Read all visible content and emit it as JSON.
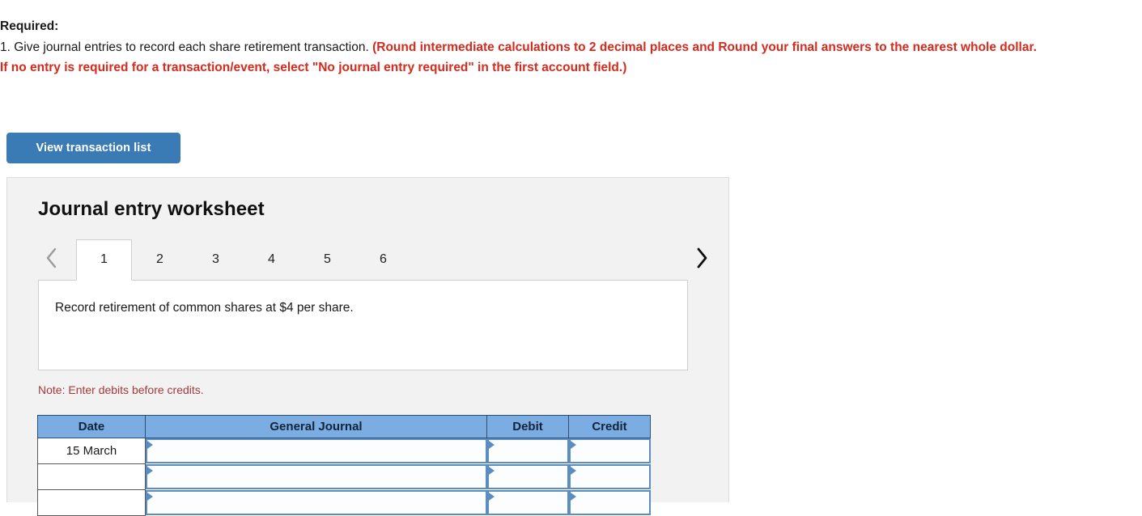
{
  "required": {
    "label": "Required:",
    "item_number": "1.",
    "instruction": "Give journal entries to record each share retirement transaction.",
    "emphasis_line1": "(Round intermediate calculations to 2 decimal places and Round",
    "emphasis_line2": "your final answers to the nearest whole dollar. If no entry is required for a transaction/event, select \"No journal entry required\" in",
    "emphasis_line3": "the first account field.)",
    "emphasis_color": "#d52b1e"
  },
  "toolbar": {
    "view_transaction_list_label": "View transaction list"
  },
  "worksheet": {
    "title": "Journal entry worksheet",
    "prev_arrow": "‹",
    "next_arrow": "›",
    "tabs": [
      {
        "label": "1",
        "active": true
      },
      {
        "label": "2",
        "active": false
      },
      {
        "label": "3",
        "active": false
      },
      {
        "label": "4",
        "active": false
      },
      {
        "label": "5",
        "active": false
      },
      {
        "label": "6",
        "active": false
      }
    ],
    "description": "Record retirement of common shares at $4 per share.",
    "note": "Note: Enter debits before credits.",
    "accent_header_color": "#7bade3",
    "button_color": "#3a7ab5"
  },
  "journal_table": {
    "columns": [
      "Date",
      "General Journal",
      "Debit",
      "Credit"
    ],
    "rows": [
      {
        "date": "15 March",
        "general_journal": "",
        "debit": "",
        "credit": ""
      },
      {
        "date": "",
        "general_journal": "",
        "debit": "",
        "credit": ""
      },
      {
        "date": "",
        "general_journal": "",
        "debit": "",
        "credit": ""
      }
    ]
  }
}
